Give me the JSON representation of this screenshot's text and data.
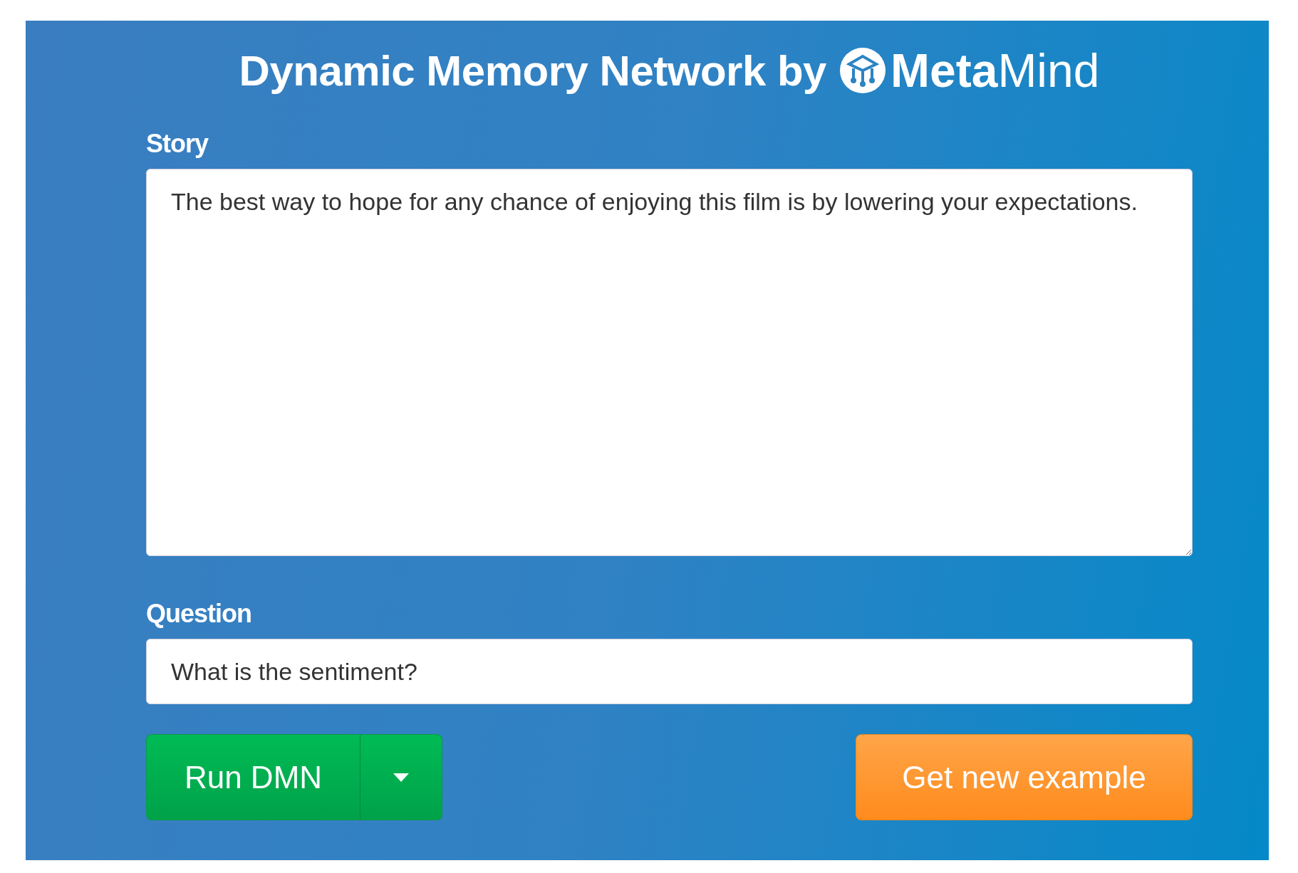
{
  "header": {
    "title": "Dynamic Memory Network by",
    "logo": "**Meta**Mind"
  },
  "story": {
    "label": "Story",
    "value": "The best way to hope for any chance of enjoying this film is by lowering your expectations."
  },
  "question": {
    "label": "Question",
    "value": "What is the sentiment?"
  },
  "buttons": {
    "run": "Run DMN",
    "new_example": "Get new example"
  }
}
